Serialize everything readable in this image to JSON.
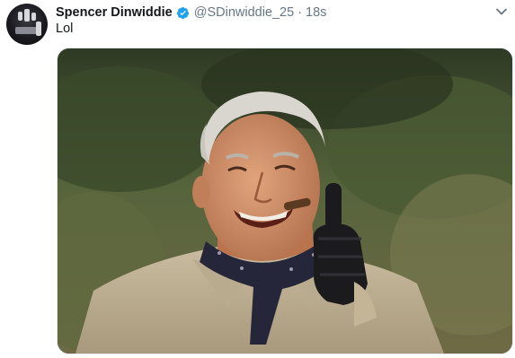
{
  "tweet": {
    "author_name": "Spencer Dinwiddie",
    "handle": "@SDinwiddie_25",
    "separator": "·",
    "timestamp": "18s",
    "text": "Lol"
  },
  "icons": {
    "verified": "verified-badge-icon",
    "menu": "chevron-down-icon"
  },
  "colors": {
    "verified": "#1da1f2",
    "secondary_text": "#657786"
  }
}
